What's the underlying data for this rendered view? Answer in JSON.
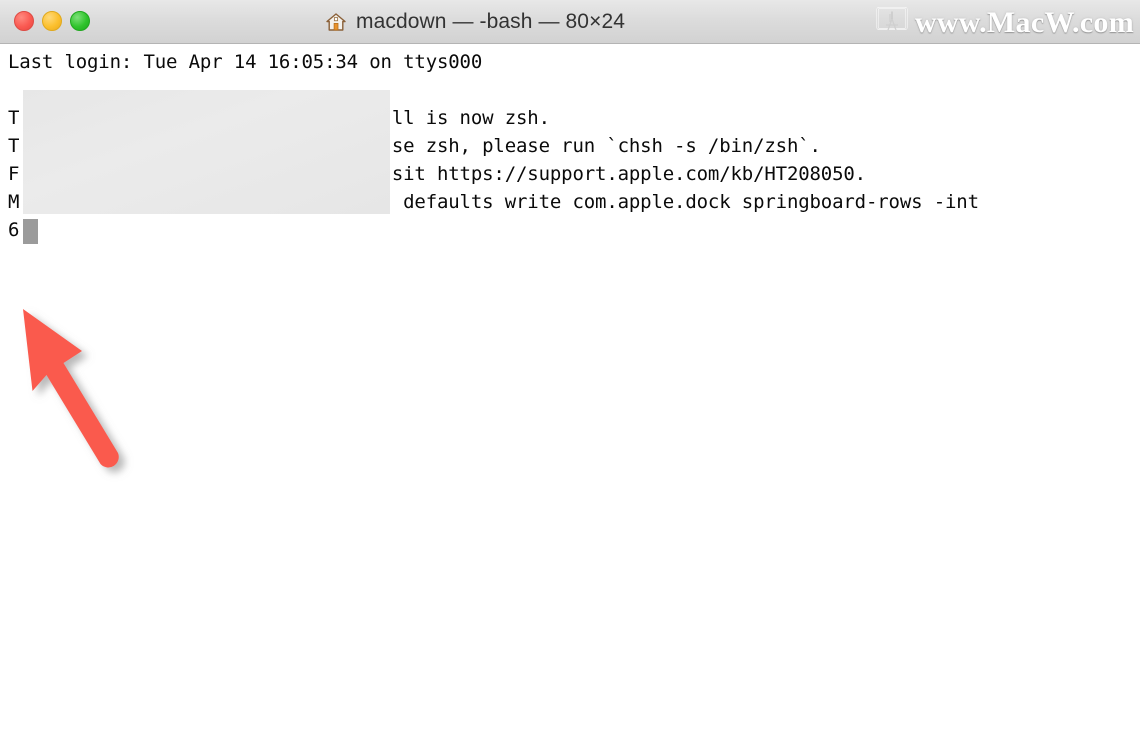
{
  "window": {
    "title": "macdown — -bash — 80×24",
    "title_icon": "home-icon",
    "traffic_lights": [
      {
        "name": "close",
        "color": "#fa5a52"
      },
      {
        "name": "minimize",
        "color": "#fcc02e"
      },
      {
        "name": "maximize",
        "color": "#2fc42c"
      }
    ]
  },
  "watermark": {
    "text": "www.MacW.com",
    "icon": "monitor-icon",
    "color": "#ffffff"
  },
  "terminal": {
    "background": "#ffffff",
    "foreground": "#0a0a0a",
    "cursor_color": "#9b9b9b",
    "redaction_color": "#e8e8e8",
    "lines": [
      "Last login: Tue Apr 14 16:05:34 on ttys000",
      "T                                 ll is now zsh.",
      "T                                 se zsh, please run `chsh -s /bin/zsh`.",
      "F                                 sit https://support.apple.com/kb/HT208050.",
      "M                                  defaults write com.apple.dock springboard-rows -int",
      "6"
    ]
  },
  "annotation": {
    "arrow_color": "#fa5a4e",
    "arrow_direction": "up-left"
  }
}
